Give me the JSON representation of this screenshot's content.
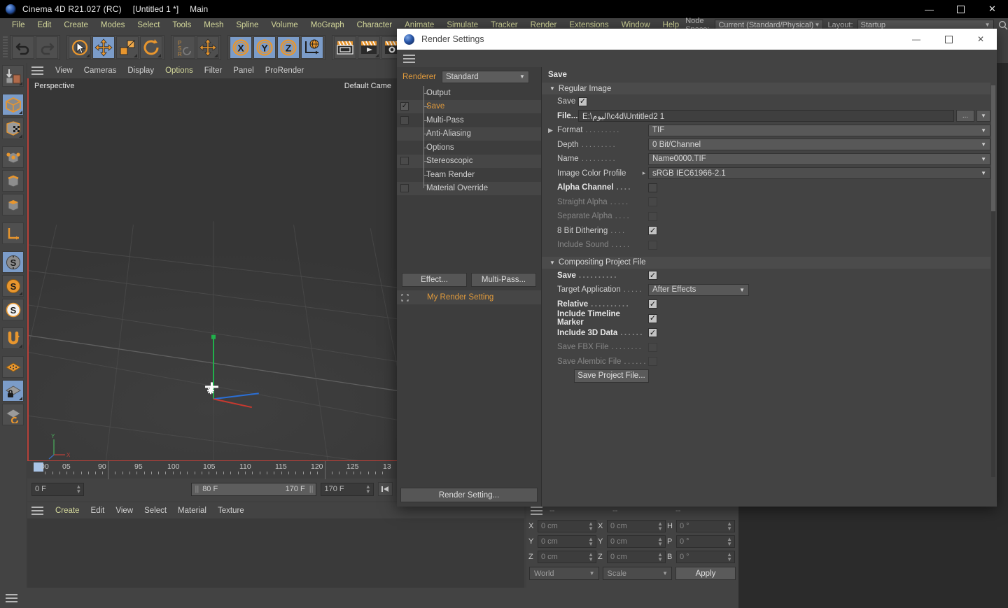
{
  "window": {
    "app_title": "Cinema 4D R21.027 (RC)",
    "document": "[Untitled 1 *]",
    "layout_name": "Main",
    "minimize": "—",
    "maximize": "☐",
    "close": "✕"
  },
  "menubar": {
    "items": [
      "File",
      "Edit",
      "Create",
      "Modes",
      "Select",
      "Tools",
      "Mesh",
      "Spline",
      "Volume",
      "MoGraph",
      "Character",
      "Animate",
      "Simulate",
      "Tracker",
      "Render",
      "Extensions",
      "Window",
      "Help"
    ],
    "node_space_label": "Node Space:",
    "node_space_value": "Current (Standard/Physical)",
    "layout_label": "Layout:",
    "layout_value": "Startup",
    "search_icon": "search-icon"
  },
  "toolbar": {
    "groups": [
      {
        "name": "undo-redo",
        "buttons": [
          {
            "icon": "undo-icon",
            "label": "Undo",
            "active": false
          },
          {
            "icon": "redo-icon",
            "label": "Redo",
            "active": false
          }
        ]
      },
      {
        "name": "transform-tools",
        "buttons": [
          {
            "icon": "select-cursor-icon",
            "label": "Live Selection",
            "active": false
          },
          {
            "icon": "move-icon",
            "label": "Move",
            "active": true
          },
          {
            "icon": "scale-icon",
            "label": "Scale",
            "active": false
          },
          {
            "icon": "rotate-icon",
            "label": "Rotate",
            "active": false
          }
        ]
      },
      {
        "name": "psr-group",
        "buttons": [
          {
            "icon": "psr-icon",
            "label": "PSR",
            "active": false
          },
          {
            "icon": "world-move-icon",
            "label": "World/Object Axis",
            "active": false
          }
        ]
      },
      {
        "name": "axis-locks",
        "buttons": [
          {
            "icon": "x-axis-icon",
            "label": "X Axis",
            "active": true
          },
          {
            "icon": "y-axis-icon",
            "label": "Y Axis",
            "active": true
          },
          {
            "icon": "z-axis-icon",
            "label": "Z Axis",
            "active": true
          },
          {
            "icon": "world-coordinate-icon",
            "label": "World Coordinate System",
            "active": true
          }
        ]
      },
      {
        "name": "render-group",
        "buttons": [
          {
            "icon": "render-view-icon",
            "label": "Render View",
            "active": false
          },
          {
            "icon": "render-to-picture-viewer-icon",
            "label": "Render to Picture Viewer",
            "active": false
          },
          {
            "icon": "render-settings-icon",
            "label": "Edit Render Settings",
            "active": false
          }
        ]
      }
    ]
  },
  "left_toolbar": {
    "buttons": [
      {
        "icon": "make-editable-icon",
        "label": "Make Editable",
        "active": false
      },
      {
        "icon": "model-mode-icon",
        "label": "Model Mode",
        "active": true
      },
      {
        "icon": "texture-mode-icon",
        "label": "Texture Mode",
        "active": false
      },
      {
        "icon": "points-mode-icon",
        "label": "Points",
        "active": false
      },
      {
        "icon": "edges-mode-icon",
        "label": "Edges",
        "active": false
      },
      {
        "icon": "polygons-mode-icon",
        "label": "Polygons",
        "active": false
      },
      {
        "icon": "axis-mode-icon",
        "label": "Enable Axis Modification",
        "active": false
      },
      {
        "icon": "snap-grey-icon",
        "label": "Enable Snapping",
        "active": true
      },
      {
        "icon": "snap-orange-icon",
        "label": "Snap Settings",
        "active": false
      },
      {
        "icon": "workplane-snap-icon",
        "label": "Workplane Snap",
        "active": false
      },
      {
        "icon": "magnet-icon",
        "label": "Magnet",
        "active": false
      },
      {
        "icon": "workplane-icon",
        "label": "Workplane",
        "active": false
      },
      {
        "icon": "workplane-lock-icon",
        "label": "Lock Workplane",
        "active": true
      },
      {
        "icon": "workplane-rotate-icon",
        "label": "Planar Workplane",
        "active": false
      }
    ]
  },
  "viewport": {
    "menu": [
      "View",
      "Cameras",
      "Display",
      "Options",
      "Filter",
      "Panel",
      "ProRender"
    ],
    "highlighted_menu": "Options",
    "label": "Perspective",
    "camera": "Default Came",
    "hamburger_icon": "hamburger-icon"
  },
  "timeline": {
    "ticks": [
      "00",
      "05",
      "90",
      "95",
      "100",
      "105",
      "110",
      "115",
      "120",
      "125",
      "13"
    ],
    "current_frame": "0 F",
    "range_start": "80 F",
    "range_end": "170 F",
    "end_frame": "170 F",
    "jump_icon": "jump-to-start-icon"
  },
  "material_manager": {
    "menu": [
      "Create",
      "Edit",
      "View",
      "Select",
      "Material",
      "Texture"
    ],
    "highlighted_menu": "Create",
    "hamburger_icon": "hamburger-icon"
  },
  "coordinates": {
    "hamburger_icon": "hamburger-icon",
    "headers": [
      "--",
      "--",
      "--"
    ],
    "rows": [
      {
        "pos_label": "X",
        "pos_value": "0 cm",
        "size_label": "X",
        "size_value": "0 cm",
        "rot_label": "H",
        "rot_value": "0 °"
      },
      {
        "pos_label": "Y",
        "pos_value": "0 cm",
        "size_label": "Y",
        "size_value": "0 cm",
        "rot_label": "P",
        "rot_value": "0 °"
      },
      {
        "pos_label": "Z",
        "pos_value": "0 cm",
        "size_label": "Z",
        "size_value": "0 cm",
        "rot_label": "B",
        "rot_value": "0 °"
      }
    ],
    "coord_system": "World",
    "mode": "Scale",
    "apply_label": "Apply"
  },
  "render_settings": {
    "title": "Render Settings",
    "icon": "cinema4d-logo-icon",
    "win_minimize": "—",
    "win_maximize": "☐",
    "win_close": "✕",
    "hamburger_icon": "hamburger-icon",
    "renderer_label": "Renderer",
    "renderer_value": "Standard",
    "tree": [
      {
        "label": "Output",
        "checkbox": "none",
        "selected": false
      },
      {
        "label": "Save",
        "checkbox": "checked",
        "selected": true
      },
      {
        "label": "Multi-Pass",
        "checkbox": "unchecked",
        "selected": false
      },
      {
        "label": "Anti-Aliasing",
        "checkbox": "none",
        "selected": false
      },
      {
        "label": "Options",
        "checkbox": "none",
        "selected": false
      },
      {
        "label": "Stereoscopic",
        "checkbox": "unchecked",
        "selected": false
      },
      {
        "label": "Team Render",
        "checkbox": "none",
        "selected": false
      },
      {
        "label": "Material Override",
        "checkbox": "unchecked",
        "selected": false
      }
    ],
    "effect_button": "Effect...",
    "multipass_button": "Multi-Pass...",
    "my_render_setting": "My Render Setting",
    "render_setting_button": "Render Setting...",
    "panel_title": "Save",
    "sections": [
      {
        "name": "Regular Image",
        "rows": [
          {
            "type": "checkbox",
            "label": "Save",
            "value": "checked",
            "bold": false,
            "dim": false,
            "dots": false
          },
          {
            "type": "file",
            "label": "File...",
            "value": "E:\\اليوم\\c4d\\Untitled2 1",
            "browse": "...",
            "bold": true
          },
          {
            "type": "select",
            "label": "Format",
            "value": "TIF",
            "arrow": true,
            "dots": true
          },
          {
            "type": "select",
            "label": "Depth",
            "value": "0 Bit/Channel",
            "dots": true
          },
          {
            "type": "select",
            "label": "Name",
            "value": "Name0000.TIF",
            "dots": true
          },
          {
            "type": "profile",
            "label": "Image Color Profile",
            "value": "sRGB IEC61966-2.1"
          },
          {
            "type": "checkbox",
            "label": "Alpha Channel",
            "value": "unchecked",
            "bold": true,
            "dots": true
          },
          {
            "type": "checkbox",
            "label": "Straight Alpha",
            "value": "unchecked",
            "dim": true,
            "dots": true
          },
          {
            "type": "checkbox",
            "label": "Separate Alpha",
            "value": "unchecked",
            "dim": true,
            "dots": true
          },
          {
            "type": "checkbox",
            "label": "8 Bit Dithering",
            "value": "checked",
            "dots": true
          },
          {
            "type": "checkbox",
            "label": "Include Sound",
            "value": "unchecked",
            "dim": true,
            "dots": true
          }
        ]
      },
      {
        "name": "Compositing Project File",
        "rows": [
          {
            "type": "checkbox",
            "label": "Save",
            "value": "checked",
            "bold": true,
            "dots": true
          },
          {
            "type": "select",
            "label": "Target Application",
            "value": "After Effects",
            "dots": true,
            "narrow": true
          },
          {
            "type": "checkbox",
            "label": "Relative",
            "value": "checked",
            "bold": true,
            "dots": true
          },
          {
            "type": "checkbox",
            "label": "Include Timeline Marker",
            "value": "checked",
            "bold": true,
            "dots": false
          },
          {
            "type": "checkbox",
            "label": "Include 3D Data",
            "value": "checked",
            "bold": true,
            "dots": true
          },
          {
            "type": "checkbox",
            "label": "Save FBX File",
            "value": "unchecked",
            "dim": true,
            "dots": true
          },
          {
            "type": "checkbox",
            "label": "Save Alembic File",
            "value": "unchecked",
            "dim": true,
            "dots": true
          },
          {
            "type": "button",
            "label": "Save Project File..."
          }
        ]
      }
    ]
  }
}
